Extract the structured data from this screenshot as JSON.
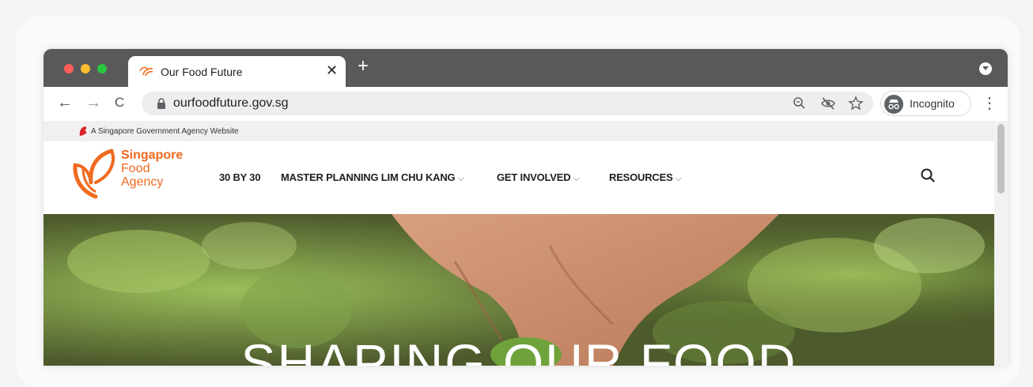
{
  "browser": {
    "tab_title": "Our Food Future",
    "new_tab_symbol": "+",
    "close_symbol": "✕",
    "url": "ourfoodfuture.gov.sg",
    "profile_label": "Incognito",
    "back_symbol": "←",
    "forward_symbol": "→",
    "reload_symbol": "C",
    "menu_symbol": "⋮",
    "icons": [
      "tab-favicon",
      "lock-icon",
      "zoom-icon",
      "eye-off-icon",
      "star-icon",
      "incognito-icon",
      "dropdown-icon"
    ]
  },
  "site": {
    "masthead_text": "A Singapore Government Agency Website",
    "logo_lines": [
      "Singapore",
      "Food",
      "Agency"
    ],
    "nav": [
      {
        "label": "30 BY 30",
        "has_dropdown": false
      },
      {
        "label": "MASTER PLANNING LIM CHU KANG",
        "has_dropdown": true
      },
      {
        "label": "GET INVOLVED",
        "has_dropdown": true
      },
      {
        "label": "RESOURCES",
        "has_dropdown": true
      }
    ],
    "hero_title": "SHAPING OUR FOOD"
  },
  "colors": {
    "brand": "#ef6a1f",
    "titlebar": "#595959",
    "omnibox": "#eeeeee",
    "masthead": "#f0f0f0"
  }
}
